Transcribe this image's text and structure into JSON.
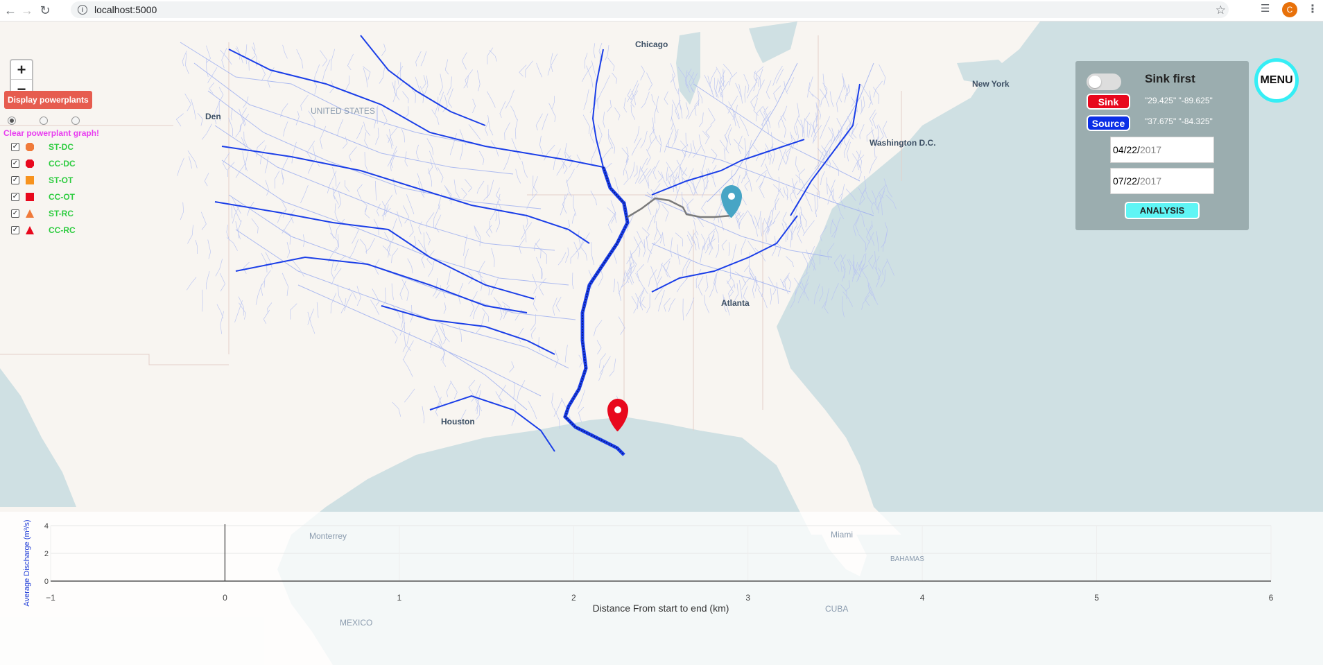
{
  "browser": {
    "url": "localhost:5000",
    "avatar_letter": "C"
  },
  "map": {
    "cities": [
      {
        "name": "Chicago",
        "label": "Chicago"
      },
      {
        "name": "New York",
        "label": "New York"
      },
      {
        "name": "Washington D.C.",
        "label": "Washington D.C."
      },
      {
        "name": "Atlanta",
        "label": "Atlanta"
      },
      {
        "name": "Houston",
        "label": "Houston"
      },
      {
        "name": "Monterrey",
        "label": "Monterrey"
      },
      {
        "name": "Miami",
        "label": "Miami"
      },
      {
        "name": "Mexico",
        "label": "MEXICO"
      },
      {
        "name": "Cuba",
        "label": "CUBA"
      },
      {
        "name": "Bahamas",
        "label": "BAHAMAS"
      },
      {
        "name": "United States",
        "label": "UNITED STATES"
      },
      {
        "name": "Denver",
        "label": "Den"
      }
    ]
  },
  "zoom": {
    "in": "+",
    "out": "−"
  },
  "left_panel": {
    "display_button": "Display powerplants",
    "clear_link": "Clear powerplant graph!",
    "legend": [
      {
        "label": "ST-DC",
        "shape": "octagon",
        "color": "#f07a3a"
      },
      {
        "label": "CC-DC",
        "shape": "octagon",
        "color": "#e8081d"
      },
      {
        "label": "ST-OT",
        "shape": "square",
        "color": "#f7931e"
      },
      {
        "label": "CC-OT",
        "shape": "square",
        "color": "#e8081d"
      },
      {
        "label": "ST-RC",
        "shape": "triangle",
        "color": "#f07a3a"
      },
      {
        "label": "CC-RC",
        "shape": "triangle",
        "color": "#e8081d"
      }
    ]
  },
  "control_panel": {
    "toggle_label": "Sink first",
    "sink_label": "Sink",
    "source_label": "Source",
    "sink_coords": "\"29.425\" \"-89.625\"",
    "source_coords": "\"37.675\" \"-84.325\"",
    "start_date_md": "04/22/",
    "start_date_y": "2017",
    "end_date_md": "07/22/",
    "end_date_y": "2017",
    "analysis_label": "ANALYSIS"
  },
  "menu_label": "MENU",
  "colors": {
    "sink": "#e8081d",
    "source": "#0b2ee6",
    "accent": "#35eef5",
    "river": "#1a3ee8"
  },
  "chart_data": {
    "type": "line",
    "xlabel": "Distance From start to end (km)",
    "ylabel": "Average Discharge (m³/s)",
    "xlim": [
      -1,
      6
    ],
    "ylim": [
      0,
      4
    ],
    "xticks": [
      "−1",
      "0",
      "1",
      "2",
      "3",
      "4",
      "5",
      "6"
    ],
    "yticks": [
      "0",
      "2",
      "4"
    ],
    "series": []
  }
}
